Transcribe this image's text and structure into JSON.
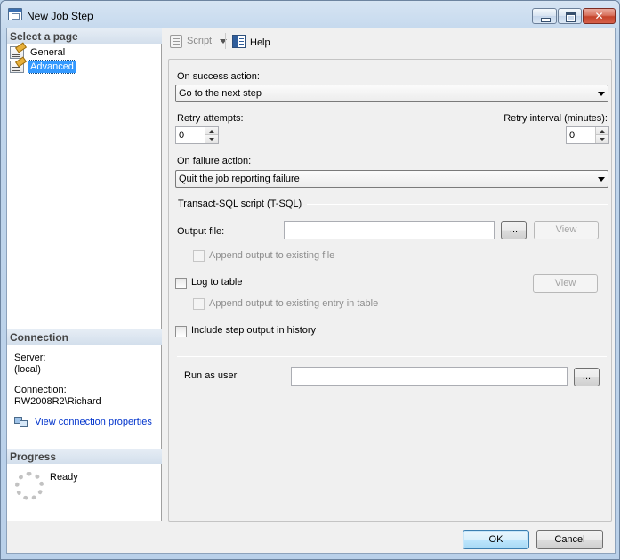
{
  "window": {
    "title": "New Job Step",
    "icon": "job-step-window-icon"
  },
  "left_panel": {
    "select_page_header": "Select a page",
    "pages": [
      {
        "label": "General",
        "icon": "page-properties-icon",
        "selected": false
      },
      {
        "label": "Advanced",
        "icon": "page-properties-icon",
        "selected": true
      }
    ],
    "connection_header": "Connection",
    "server_label": "Server:",
    "server_value": "(local)",
    "connection_label": "Connection:",
    "connection_value": "RW2008R2\\Richard",
    "view_connection_link": "View connection properties",
    "progress_header": "Progress",
    "progress_status": "Ready"
  },
  "toolbar": {
    "script_label": "Script",
    "help_label": "Help"
  },
  "form": {
    "on_success_label": "On success action:",
    "on_success_value": "Go to the next step",
    "retry_attempts_label": "Retry attempts:",
    "retry_attempts_value": "0",
    "retry_interval_label": "Retry interval (minutes):",
    "retry_interval_value": "0",
    "on_failure_label": "On failure action:",
    "on_failure_value": "Quit the job reporting failure",
    "tsql_group_label": "Transact-SQL script (T-SQL)",
    "output_file_label": "Output file:",
    "output_file_value": "",
    "browse_label": "...",
    "view_label": "View",
    "append_output_label": "Append output to existing file",
    "log_to_table_label": "Log to table",
    "log_view_label": "View",
    "append_entry_label": "Append output to existing entry in table",
    "include_history_label": "Include step output in history",
    "run_as_user_label": "Run as user",
    "run_as_user_value": "",
    "run_as_browse_label": "..."
  },
  "footer": {
    "ok_label": "OK",
    "cancel_label": "Cancel"
  }
}
